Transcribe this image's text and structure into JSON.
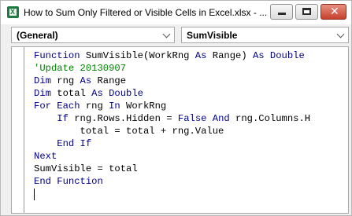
{
  "window": {
    "title": "How to Sum Only Filtered or Visible Cells in Excel.xlsx - ...",
    "icon": "excel-icon"
  },
  "toolbar": {
    "object_dropdown": "(General)",
    "procedure_dropdown": "SumVisible"
  },
  "colors": {
    "keyword": "#00008b",
    "comment": "#008000",
    "text": "#000000"
  },
  "code_lines": [
    [
      {
        "t": "Function ",
        "k": "kw"
      },
      {
        "t": "SumVisible(WorkRng "
      },
      {
        "t": "As",
        "k": "kw"
      },
      {
        "t": " Range) "
      },
      {
        "t": "As Double",
        "k": "kw"
      }
    ],
    [
      {
        "t": "'Update 20130907",
        "k": "cm"
      }
    ],
    [
      {
        "t": "Dim",
        "k": "kw"
      },
      {
        "t": " rng "
      },
      {
        "t": "As",
        "k": "kw"
      },
      {
        "t": " Range"
      }
    ],
    [
      {
        "t": "Dim",
        "k": "kw"
      },
      {
        "t": " total "
      },
      {
        "t": "As Double",
        "k": "kw"
      }
    ],
    [
      {
        "t": "For Each",
        "k": "kw"
      },
      {
        "t": " rng "
      },
      {
        "t": "In",
        "k": "kw"
      },
      {
        "t": " WorkRng"
      }
    ],
    [
      {
        "t": "    "
      },
      {
        "t": "If",
        "k": "kw"
      },
      {
        "t": " rng.Rows.Hidden = "
      },
      {
        "t": "False And",
        "k": "kw"
      },
      {
        "t": " rng.Columns.H"
      }
    ],
    [
      {
        "t": "        total = total + rng.Value"
      }
    ],
    [
      {
        "t": "    "
      },
      {
        "t": "End If",
        "k": "kw"
      }
    ],
    [
      {
        "t": "Next",
        "k": "kw"
      }
    ],
    [
      {
        "t": "SumVisible = total"
      }
    ],
    [
      {
        "t": "End Function",
        "k": "kw"
      }
    ]
  ]
}
